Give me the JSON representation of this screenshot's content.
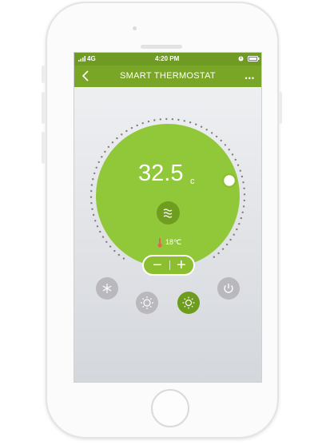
{
  "status": {
    "signal": "4G",
    "time": "4:20 PM"
  },
  "header": {
    "title": "SMART THERMOSTAT",
    "more": "•••"
  },
  "dial": {
    "temperature": "32.5",
    "unit": "c",
    "room_temperature": "18℃"
  },
  "controls": {
    "minus": "−",
    "plus": "+"
  },
  "colors": {
    "accent": "#7aa628",
    "dial": "#90c83a",
    "inactive": "#b9b9bd"
  },
  "modes": [
    {
      "icon": "snowflake-icon",
      "active": false
    },
    {
      "icon": "dim-sun-icon",
      "active": false
    },
    {
      "icon": "sun-icon",
      "active": true
    },
    {
      "icon": "power-icon",
      "active": false
    }
  ]
}
